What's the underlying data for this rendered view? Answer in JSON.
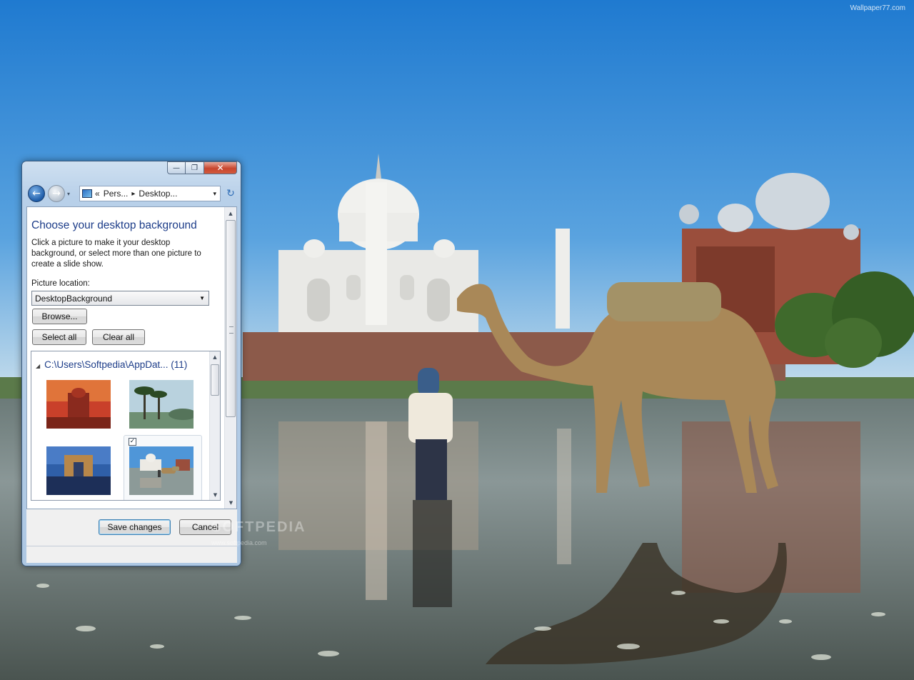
{
  "wallpaper": {
    "watermark": "Wallpaper77.com"
  },
  "window": {
    "caption": {
      "minimize": "—",
      "maximize": "❐",
      "close": "✕"
    },
    "nav": {
      "back": "←",
      "forward": "→",
      "history": "▾"
    },
    "address": {
      "prefix": "«",
      "crumb1": "Pers...",
      "sep": "▸",
      "crumb2": "Desktop...",
      "dropdown": "▾"
    },
    "refresh": "↻"
  },
  "content": {
    "title": "Choose your desktop background",
    "description": "Click a picture to make it your desktop background, or select more than one picture to create a slide show.",
    "picture_location_label": "Picture location:",
    "picture_location_value": "DesktopBackground",
    "browse_label": "Browse...",
    "select_all_label": "Select all",
    "clear_all_label": "Clear all",
    "group": {
      "path": "C:\\Users\\Softpedia\\AppDat...",
      "count": "(11)"
    },
    "thumbnails": [
      {
        "name": "red-palace",
        "selected": false
      },
      {
        "name": "palm-beach",
        "selected": false
      },
      {
        "name": "gateway-night",
        "selected": false
      },
      {
        "name": "taj-camel",
        "selected": true
      }
    ],
    "checkmark": "✓"
  },
  "footer": {
    "save_label": "Save changes",
    "cancel_label": "Cancel"
  },
  "overlay": {
    "softpedia": "SOFTPEDIA",
    "softpedia_url": "www.softpedia.com"
  },
  "icons": {
    "back": "back-arrow-icon",
    "forward": "forward-arrow-icon",
    "refresh": "refresh-icon",
    "computer": "computer-icon",
    "collapse": "collapse-triangle-icon"
  }
}
